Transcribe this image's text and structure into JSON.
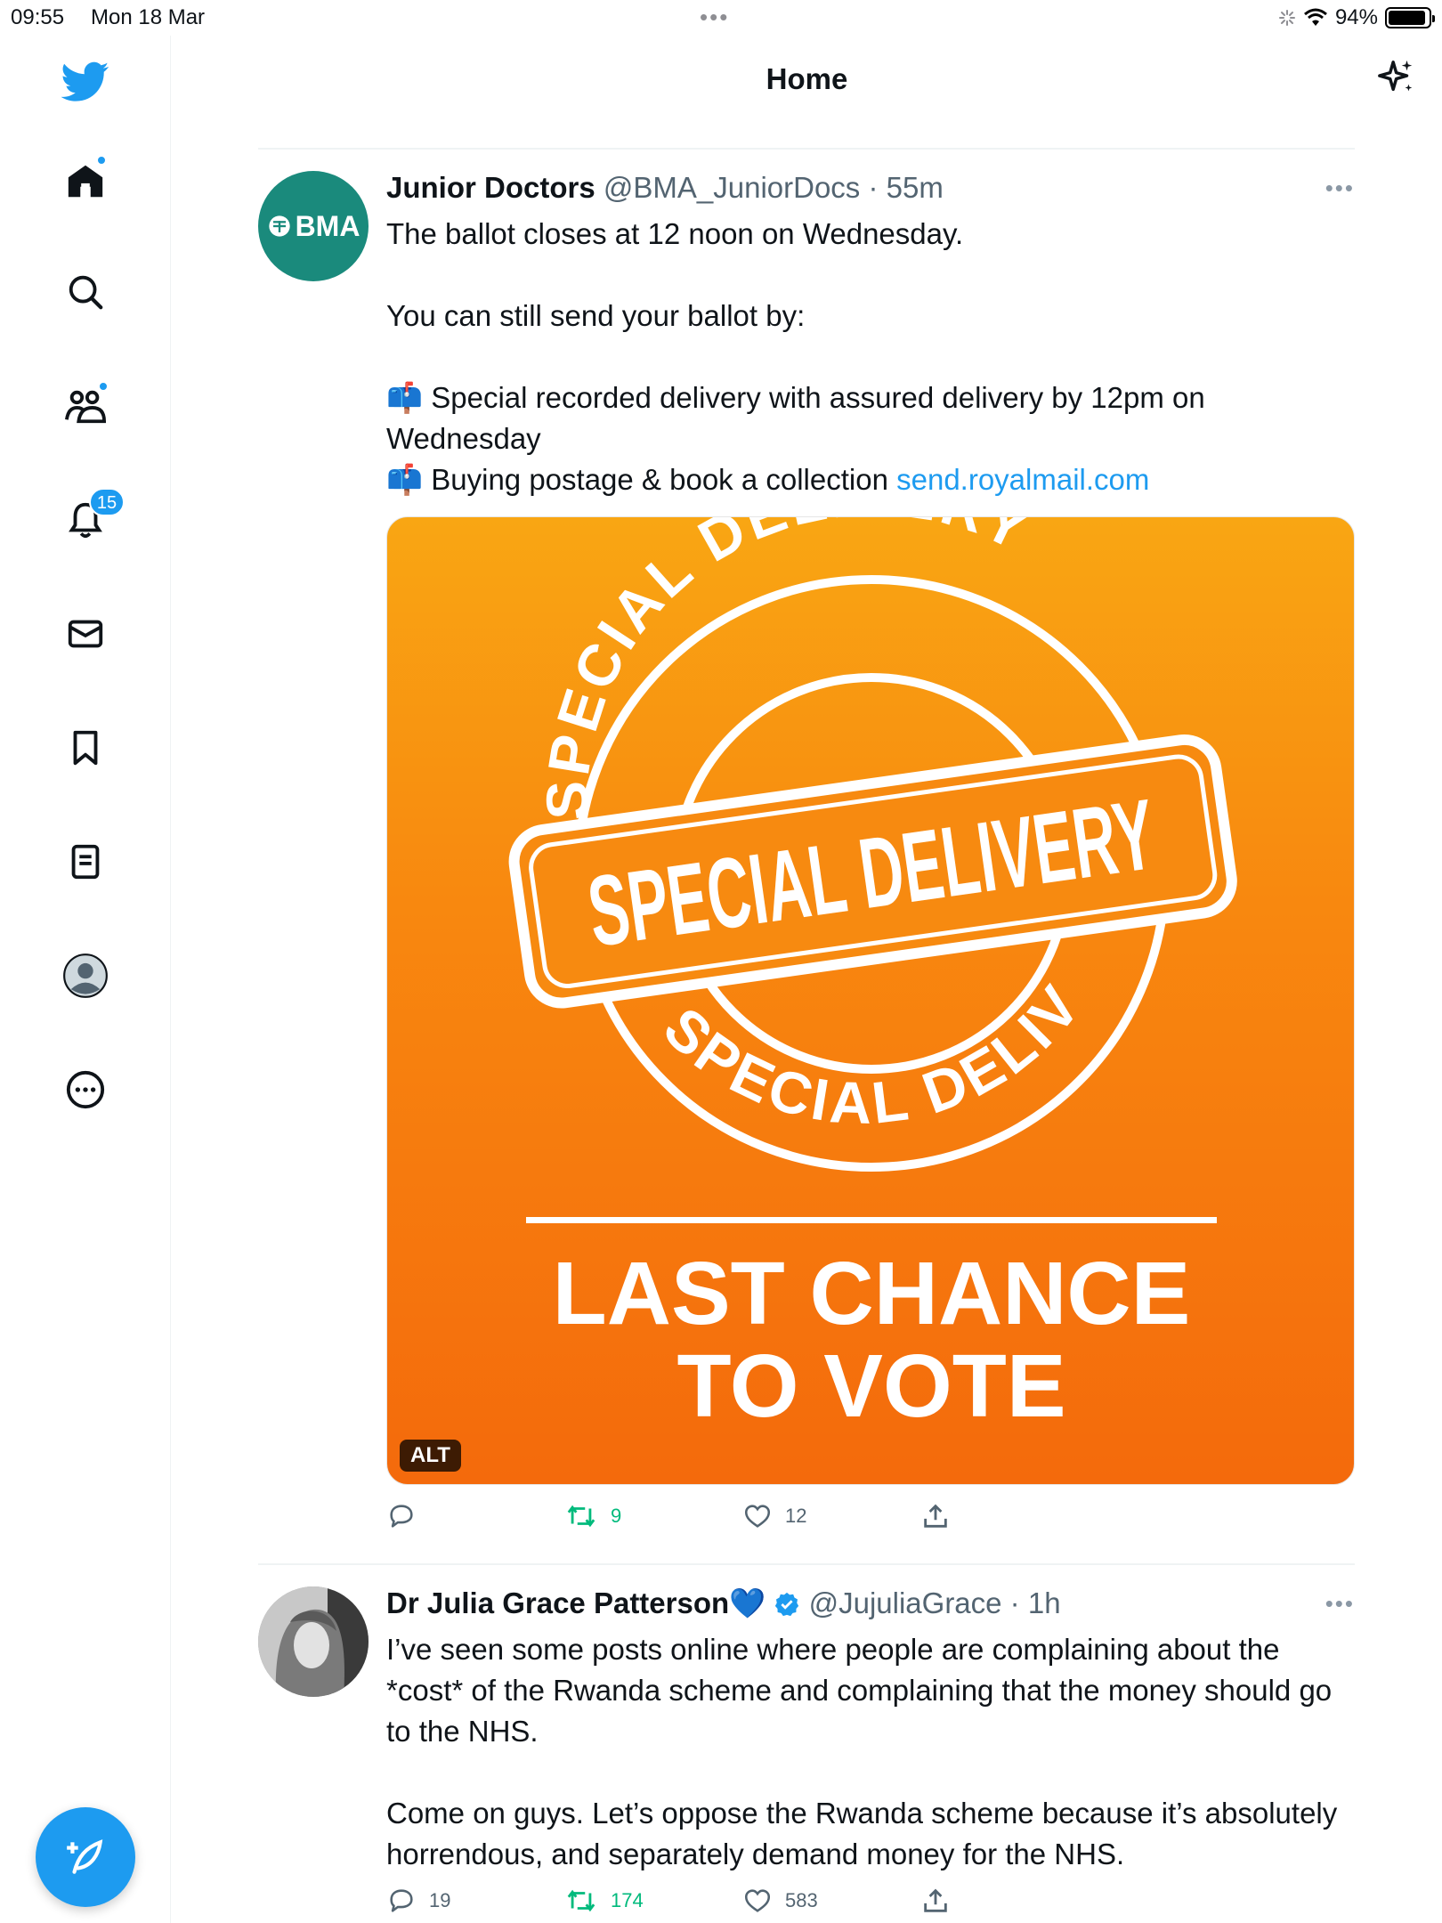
{
  "status": {
    "time": "09:55",
    "date": "Mon 18 Mar",
    "battery": "94%",
    "battery_level": 0.94
  },
  "header": {
    "title": "Home"
  },
  "sidebar": {
    "notifications_badge": "15",
    "items": [
      "home-icon",
      "search-icon",
      "communities-icon",
      "bell-icon",
      "mail-icon",
      "bookmark-icon",
      "lists-icon",
      "profile-icon",
      "more-icon"
    ]
  },
  "tweets": [
    {
      "avatar_text": "BMA",
      "name": "Junior Doctors",
      "handle": "@BMA_JuniorDocs",
      "time": "55m",
      "lines": [
        "The ballot closes at 12 noon on Wednesday.",
        "You can still send your ballot by:",
        "📫 Special recorded delivery with assured delivery by 12pm on Wednesday",
        "📫 Buying postage & book a collection "
      ],
      "link": "send.royalmail.com",
      "media": {
        "stamp_top": "SPECIAL DELIVERY",
        "stamp_center": "SPECIAL DELIVERY",
        "stamp_bottom": "SPECIAL DELIVERY",
        "headline_1": "LAST CHANCE",
        "headline_2": "TO VOTE",
        "alt_label": "ALT"
      },
      "replies": "",
      "retweets": "9",
      "likes": "12"
    },
    {
      "name": "Dr Julia Grace Patterson💙",
      "handle": "@JujuliaGrace",
      "time": "1h",
      "lines": [
        "I’ve seen some posts online where people are complaining about the *cost* of the Rwanda scheme and complaining that the money should go to the NHS.",
        "Come on guys. Let’s oppose the Rwanda scheme because it’s absolutely horrendous, and separately demand money for the NHS."
      ],
      "replies": "19",
      "retweets": "174",
      "likes": "583"
    }
  ],
  "colors": {
    "accent": "#1d9bf0",
    "retweet": "#00ba7c",
    "bma": "#1a8a7c",
    "orange": "#f8880f"
  }
}
